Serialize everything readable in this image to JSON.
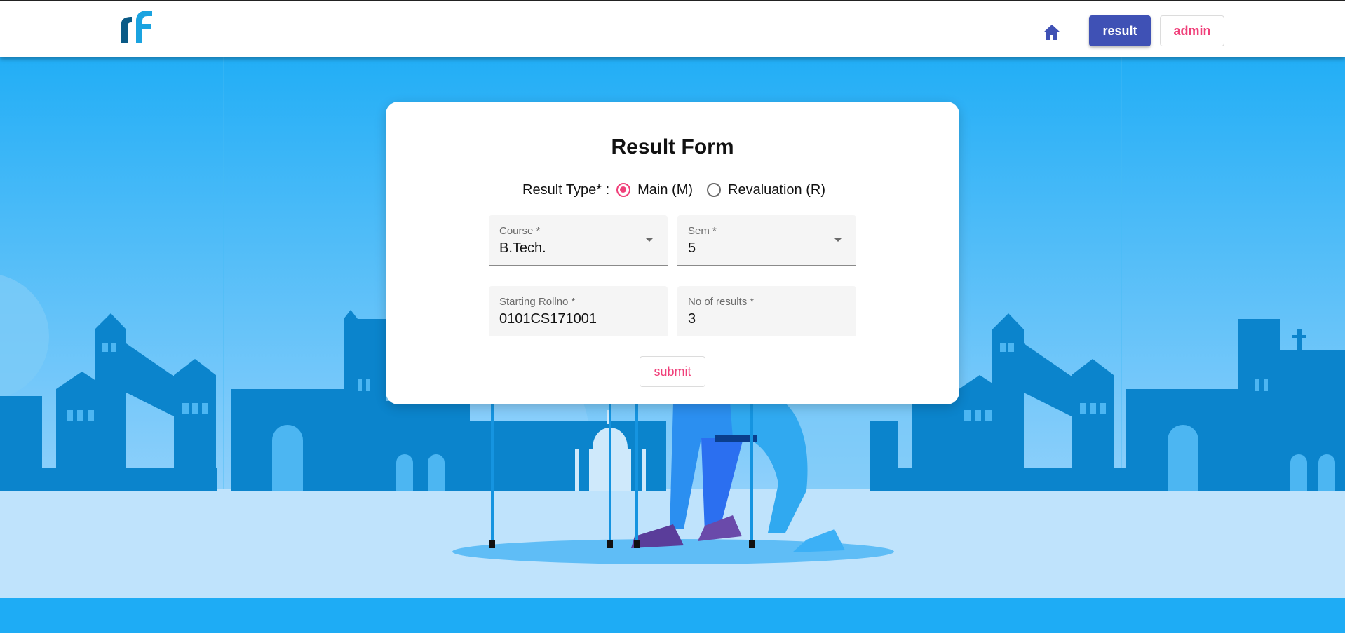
{
  "header": {
    "logo_text": "rf",
    "nav": {
      "home_icon": "home-icon",
      "result_label": "result",
      "admin_label": "admin"
    }
  },
  "form": {
    "title": "Result Form",
    "result_type": {
      "label": "Result Type* :",
      "options": [
        {
          "label": "Main (M)",
          "selected": true
        },
        {
          "label": "Revaluation (R)",
          "selected": false
        }
      ]
    },
    "course": {
      "label": "Course *",
      "value": "B.Tech."
    },
    "sem": {
      "label": "Sem *",
      "value": "5"
    },
    "starting_rollno": {
      "label": "Starting Rollno *",
      "value": "0101CS171001"
    },
    "no_of_results": {
      "label": "No of results *",
      "value": "3"
    },
    "submit_label": "submit"
  },
  "colors": {
    "primary": "#3f51b5",
    "accent": "#f0407a",
    "sky": "#1eacf5",
    "skyline": "#0b84cc"
  }
}
